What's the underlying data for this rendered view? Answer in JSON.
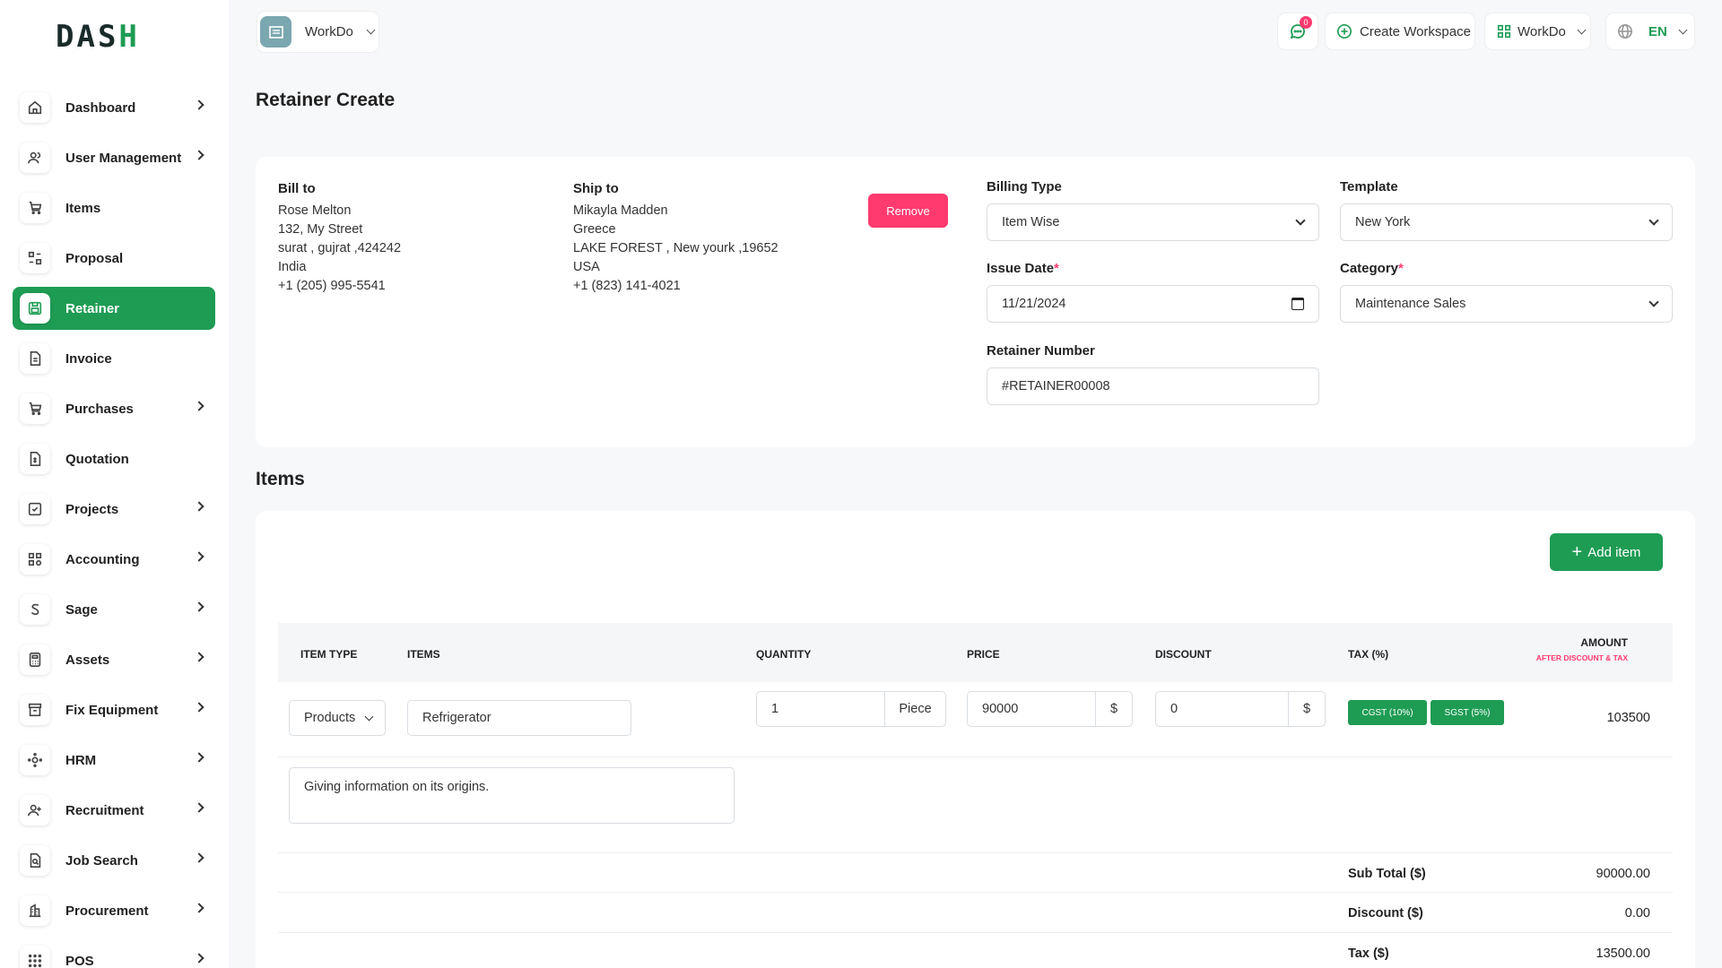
{
  "brand": {
    "logo_main": "DAS",
    "logo_accent": "H"
  },
  "sidebar": {
    "items": [
      {
        "label": "Dashboard",
        "icon": "home-icon",
        "chevron": true
      },
      {
        "label": "User Management",
        "icon": "users-icon",
        "chevron": true
      },
      {
        "label": "Items",
        "icon": "cart-icon",
        "chevron": false
      },
      {
        "label": "Proposal",
        "icon": "swap-icon",
        "chevron": false
      },
      {
        "label": "Retainer",
        "icon": "save-icon",
        "chevron": false,
        "active": true
      },
      {
        "label": "Invoice",
        "icon": "file-icon",
        "chevron": false
      },
      {
        "label": "Purchases",
        "icon": "cart-icon",
        "chevron": true
      },
      {
        "label": "Quotation",
        "icon": "file-dollar-icon",
        "chevron": false
      },
      {
        "label": "Projects",
        "icon": "checkbox-icon",
        "chevron": true
      },
      {
        "label": "Accounting",
        "icon": "grid-icon",
        "chevron": true
      },
      {
        "label": "Sage",
        "icon": "letter-s-icon",
        "chevron": true
      },
      {
        "label": "Assets",
        "icon": "calculator-icon",
        "chevron": true
      },
      {
        "label": "Fix Equipment",
        "icon": "archive-icon",
        "chevron": true
      },
      {
        "label": "HRM",
        "icon": "hrm-icon",
        "chevron": true
      },
      {
        "label": "Recruitment",
        "icon": "user-plus-icon",
        "chevron": true
      },
      {
        "label": "Job Search",
        "icon": "file-search-icon",
        "chevron": true
      },
      {
        "label": "Procurement",
        "icon": "building-icon",
        "chevron": true
      },
      {
        "label": "POS",
        "icon": "dots-grid-icon",
        "chevron": true
      }
    ]
  },
  "header": {
    "workspace": "WorkDo",
    "notification_count": "0",
    "create_workspace": "Create Workspace",
    "workspace_menu": "WorkDo",
    "language": "EN"
  },
  "page": {
    "title": "Retainer Create"
  },
  "bill_to": {
    "title": "Bill to",
    "name": "Rose Melton",
    "street": "132, My Street",
    "city": "surat , gujrat ,424242",
    "country": "India",
    "phone": "+1 (205) 995-5541"
  },
  "ship_to": {
    "title": "Ship to",
    "name": "Mikayla Madden",
    "street": "Greece",
    "city": "LAKE FOREST , New yourk ,19652",
    "country": "USA",
    "phone": "+1 (823) 141-4021"
  },
  "remove_label": "Remove",
  "form": {
    "billing_type": {
      "label": "Billing Type",
      "value": "Item Wise"
    },
    "template": {
      "label": "Template",
      "value": "New York"
    },
    "issue_date": {
      "label": "Issue Date",
      "value": "11/21/2024",
      "required": "*"
    },
    "category": {
      "label": "Category",
      "value": "Maintenance Sales",
      "required": "*"
    },
    "retainer_number": {
      "label": "Retainer Number",
      "value": "#RETAINER00008"
    }
  },
  "items_section": {
    "title": "Items",
    "add_item": "Add item",
    "columns": {
      "item_type": "ITEM TYPE",
      "items": "ITEMS",
      "quantity": "QUANTITY",
      "price": "PRICE",
      "discount": "DISCOUNT",
      "tax": "TAX (%)",
      "amount": "AMOUNT",
      "amount_note": "AFTER DISCOUNT & TAX"
    },
    "row": {
      "item_type": "Products",
      "item": "Refrigerator",
      "quantity": "1",
      "unit": "Piece",
      "price": "90000",
      "price_currency": "$",
      "discount": "0",
      "discount_currency": "$",
      "taxes": [
        "CGST (10%)",
        "SGST (5%)"
      ],
      "amount": "103500",
      "description": "Giving information on its origins."
    },
    "totals": {
      "sub_total_label": "Sub Total ($)",
      "sub_total": "90000.00",
      "discount_label": "Discount ($)",
      "discount": "0.00",
      "tax_label": "Tax ($)",
      "tax": "13500.00"
    }
  },
  "colors": {
    "accent": "#1e9c54",
    "danger": "#ff3a6e"
  }
}
